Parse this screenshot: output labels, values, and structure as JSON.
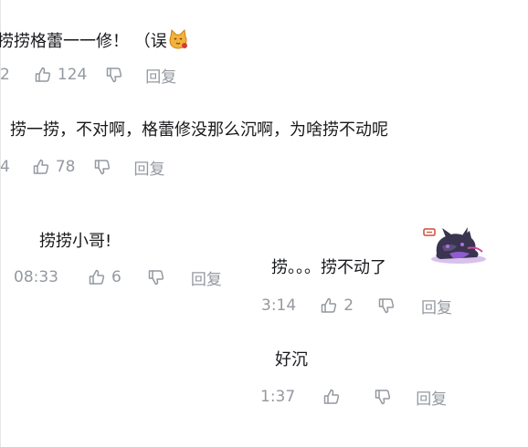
{
  "comments": [
    {
      "text": "捞捞格蕾一一修！ （误",
      "time": "2",
      "likes": "124",
      "reply_label": "回复"
    },
    {
      "text": "捞一捞，不对啊，格蕾修没那么沉啊，为啥捞不动呢",
      "time": "4",
      "likes": "78",
      "reply_label": "回复"
    },
    {
      "text": "捞捞小哥!",
      "time": "08:33",
      "likes": "6",
      "reply_label": "回复"
    },
    {
      "text": "捞。。。捞不动了",
      "time": "3:14",
      "likes": "2",
      "reply_label": "回复"
    },
    {
      "text": "好沉",
      "time": "1:37",
      "likes": "",
      "reply_label": "回复"
    }
  ],
  "icons": {
    "like": "thumbs-up-icon",
    "dislike": "thumbs-down-icon",
    "emoji": "cat-emoji-icon",
    "sticker": "sticker-image"
  },
  "colors": {
    "text": "#18191c",
    "meta": "#9499a0",
    "background": "#ffffff"
  }
}
